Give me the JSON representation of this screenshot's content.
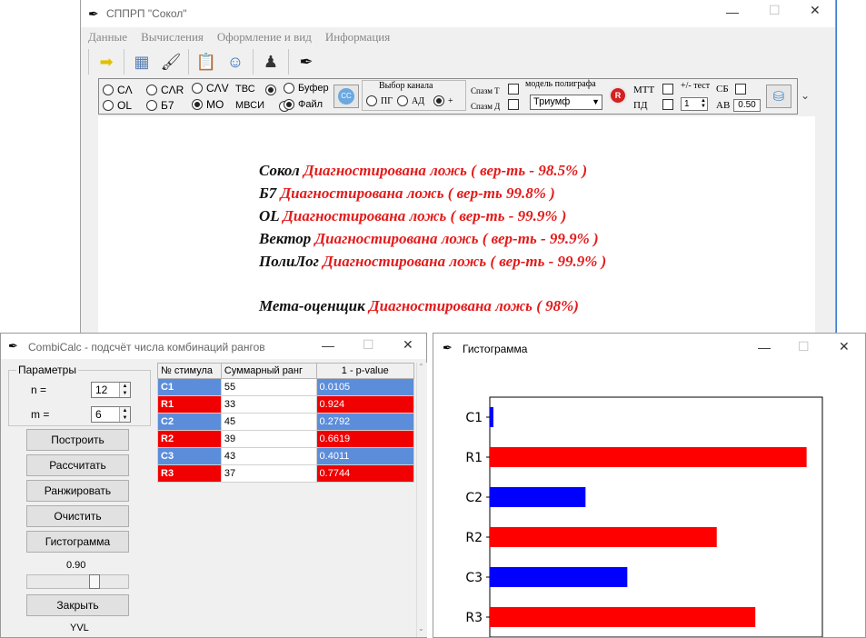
{
  "main": {
    "title": "СППРП \"Сокол\"",
    "menu": [
      "Данные",
      "Вычисления",
      "Оформление и вид",
      "Информация"
    ],
    "toolbar_icons": [
      "arrow-icon",
      "calculator-icon",
      "brush-icon",
      "clipboard-icon",
      "head-icon",
      "person-icon",
      "logo-icon"
    ],
    "options": {
      "row1": [
        "CΛ",
        "CΛR",
        "CΛV"
      ],
      "row2": [
        "OL",
        "Б7",
        "MO"
      ],
      "tvs": "ТВС",
      "mvsi": "МВСИ",
      "buffer": "Буфер",
      "file": "Файл",
      "cc": "CC",
      "channel_title": "Выбор канала",
      "channels": [
        "ПГ",
        "АД",
        "+"
      ],
      "spasm_t": "Спазм Т",
      "spasm_d": "Спазм Д",
      "model_label": "модель полиграфа",
      "model_value": "Триумф",
      "r_btn": "R",
      "mtt": "МТТ",
      "pd": "ПД",
      "test_label": "+/- тест",
      "test_value": "1",
      "sb": "СБ",
      "av": "АВ",
      "av_value": "0.50"
    },
    "results": [
      {
        "label": "Сокол",
        "value": "Диагностирована ложь ( вер-ть - 98.5% )"
      },
      {
        "label": "Б7",
        "value": "Диагностирована ложь ( вер-ть 99.8% )"
      },
      {
        "label": "OL",
        "value": "Диагностирована ложь ( вер-ть - 99.9% )"
      },
      {
        "label": "Вектор",
        "value": "Диагностирована ложь ( вер-ть - 99.9% )"
      },
      {
        "label": "ПолиЛог",
        "value": "Диагностирована ложь ( вер-ть - 99.9% )"
      }
    ],
    "meta": {
      "label": "Мета-оценщик",
      "value": "Диагностирована ложь ( 98%)"
    }
  },
  "combi": {
    "title": "CombiCalc - подсчёт числа комбинаций рангов",
    "params_title": "Параметры",
    "n_label": "n =",
    "n_value": "12",
    "m_label": "m =",
    "m_value": "6",
    "buttons": [
      "Построить",
      "Рассчитать",
      "Ранжировать",
      "Очистить",
      "Гистограмма"
    ],
    "slider_value": "0.90",
    "slider_fraction": 0.9,
    "close": "Закрыть",
    "footer": "YVL",
    "columns": [
      "№ стимула",
      "Суммарный ранг",
      "1 - p-value"
    ],
    "rows": [
      {
        "id": "C1",
        "rank": "55",
        "p": "0.0105",
        "color": "blue"
      },
      {
        "id": "R1",
        "rank": "33",
        "p": "0.924",
        "color": "red"
      },
      {
        "id": "C2",
        "rank": "45",
        "p": "0.2792",
        "color": "blue"
      },
      {
        "id": "R2",
        "rank": "39",
        "p": "0.6619",
        "color": "red"
      },
      {
        "id": "C3",
        "rank": "43",
        "p": "0.4011",
        "color": "blue"
      },
      {
        "id": "R3",
        "rank": "37",
        "p": "0.7744",
        "color": "red"
      }
    ]
  },
  "histo": {
    "title": "Гистограмма"
  },
  "chart_data": {
    "type": "bar",
    "orientation": "horizontal",
    "categories": [
      "C1",
      "R1",
      "C2",
      "R2",
      "C3",
      "R3"
    ],
    "values": [
      0.0105,
      0.924,
      0.2792,
      0.6619,
      0.4011,
      0.7744
    ],
    "colors": [
      "#0000ff",
      "#ff0000",
      "#0000ff",
      "#ff0000",
      "#0000ff",
      "#ff0000"
    ],
    "xticks": [
      "0.0",
      "0.2",
      "0.4",
      "0.6",
      "0.8"
    ],
    "xlim": [
      0,
      0.97
    ],
    "title": "",
    "xlabel": "",
    "ylabel": ""
  },
  "colors": {
    "result_red": "#e31b1b",
    "cell_blue": "#5b8ddb",
    "cell_red": "#f00000"
  }
}
